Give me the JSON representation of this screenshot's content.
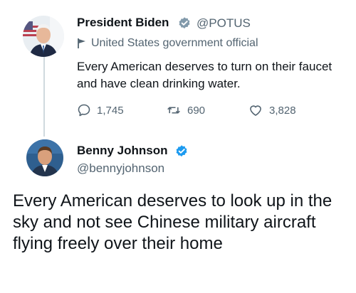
{
  "tweet": {
    "author_name": "President Biden",
    "handle": "@POTUS",
    "label": "United States government official",
    "text": "Every American deserves to turn on their faucet and have clean drinking water.",
    "actions": {
      "replies": "1,745",
      "retweets": "690",
      "likes": "3,828"
    }
  },
  "reply": {
    "author_name": "Benny Johnson",
    "handle": "@bennyjohnson",
    "text": "Every American deserves to look up in the sky and not see Chinese military aircraft flying freely over their home"
  },
  "colors": {
    "verified_gray": "#829aab",
    "verified_blue": "#1d9bf0",
    "secondary_text": "#536471",
    "thread_line": "#cfd9de"
  },
  "icons": [
    "verified-badge-icon",
    "flag-icon",
    "reply-icon",
    "retweet-icon",
    "like-icon"
  ]
}
